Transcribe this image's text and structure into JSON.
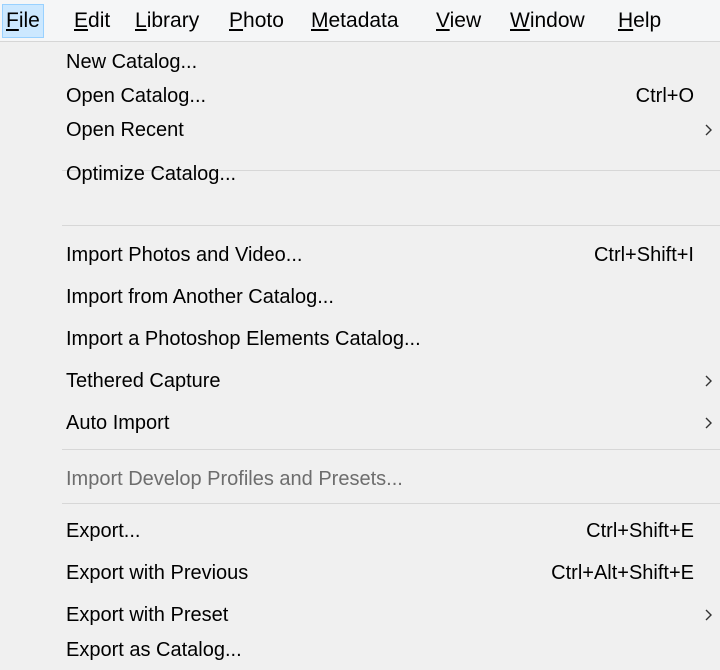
{
  "menubar": {
    "items": [
      {
        "pre": "",
        "key": "F",
        "post": "ile"
      },
      {
        "pre": "",
        "key": "E",
        "post": "dit"
      },
      {
        "pre": "",
        "key": "L",
        "post": "ibrary"
      },
      {
        "pre": "",
        "key": "P",
        "post": "hoto"
      },
      {
        "pre": "",
        "key": "M",
        "post": "etadata"
      },
      {
        "pre": "",
        "key": "V",
        "post": "iew"
      },
      {
        "pre": "",
        "key": "W",
        "post": "indow"
      },
      {
        "pre": "",
        "key": "H",
        "post": "elp"
      }
    ],
    "active": "File"
  },
  "file_menu": {
    "items": [
      {
        "label": "New Catalog...",
        "shortcut": "",
        "submenu": false,
        "enabled": true
      },
      {
        "label": "Open Catalog...",
        "shortcut": "Ctrl+O",
        "submenu": false,
        "enabled": true
      },
      {
        "label": "Open Recent",
        "shortcut": "",
        "submenu": true,
        "enabled": true
      },
      {
        "label": "Optimize Catalog...",
        "shortcut": "",
        "submenu": false,
        "enabled": true
      },
      {
        "label": "Import Photos and Video...",
        "shortcut": "Ctrl+Shift+I",
        "submenu": false,
        "enabled": true
      },
      {
        "label": "Import from Another Catalog...",
        "shortcut": "",
        "submenu": false,
        "enabled": true
      },
      {
        "label": "Import a Photoshop Elements Catalog...",
        "shortcut": "",
        "submenu": false,
        "enabled": true
      },
      {
        "label": "Tethered Capture",
        "shortcut": "",
        "submenu": true,
        "enabled": true
      },
      {
        "label": "Auto Import",
        "shortcut": "",
        "submenu": true,
        "enabled": true
      },
      {
        "label": "Import Develop Profiles and Presets...",
        "shortcut": "",
        "submenu": false,
        "enabled": false
      },
      {
        "label": "Export...",
        "shortcut": "Ctrl+Shift+E",
        "submenu": false,
        "enabled": true
      },
      {
        "label": "Export with Previous",
        "shortcut": "Ctrl+Alt+Shift+E",
        "submenu": false,
        "enabled": true
      },
      {
        "label": "Export with Preset",
        "shortcut": "",
        "submenu": true,
        "enabled": true
      },
      {
        "label": "Export as Catalog...",
        "shortcut": "",
        "submenu": false,
        "enabled": true
      }
    ]
  }
}
